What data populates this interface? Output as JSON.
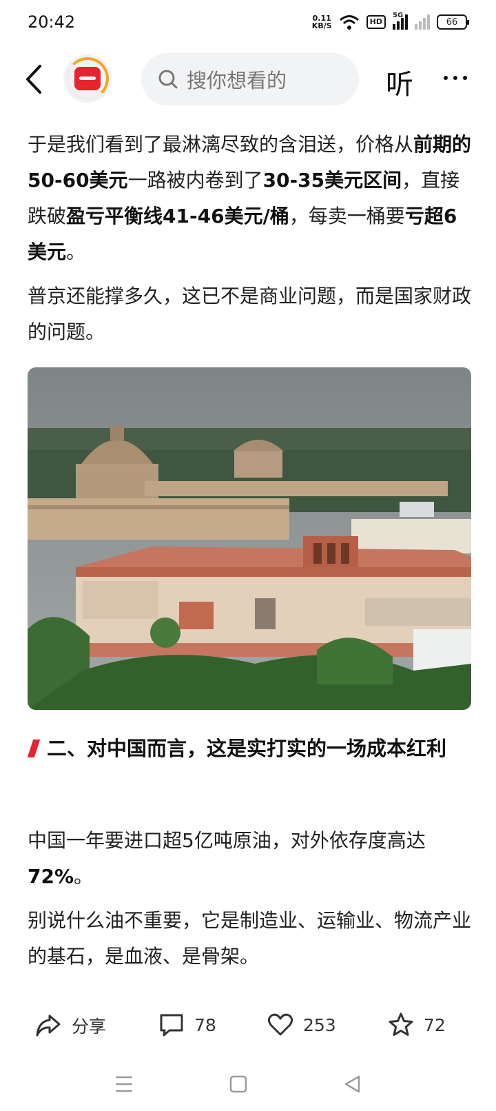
{
  "status_bar": {
    "time": "20:42",
    "speed_value": "0.11",
    "speed_unit": "KB/S",
    "hd_label": "HD",
    "network_label": "5G",
    "battery": "66"
  },
  "top_nav": {
    "search_placeholder": "搜你想看的",
    "listen_label": "听",
    "back_icon": "back-arrow-icon",
    "more_icon": "more-dots-icon"
  },
  "article": {
    "para1": {
      "t1": "于是我们看到了最淋漓尽致的含泪送，价格从",
      "b1": "前期的50-60美元",
      "t2": "一路被内卷到了",
      "b2": "30-35美元区间",
      "t3": "，直接跌破",
      "b3": "盈亏平衡线41-46美元/桶",
      "t4": "，每卖一桶要",
      "b4": "亏超6美元",
      "t5": "。"
    },
    "para2": "普京还能撑多久，这已不是商业问题，而是国家财政的问题。",
    "heading": "二、对中国而言，这是实打实的一场成本红利",
    "para3": {
      "t1": "中国一年要进口超5亿吨原油，对外依存度高达",
      "b1": "72%",
      "t2": "。"
    },
    "para4": "别说什么油不重要，它是制造业、运输业、物流产业的基石，是血液、是骨架。"
  },
  "actions": {
    "share_label": "分享",
    "comments": "78",
    "likes": "253",
    "favorites": "72"
  },
  "colors": {
    "accent_red": "#e4252d",
    "logo_orange": "#f5a623",
    "search_bg": "#f2f3f5"
  }
}
